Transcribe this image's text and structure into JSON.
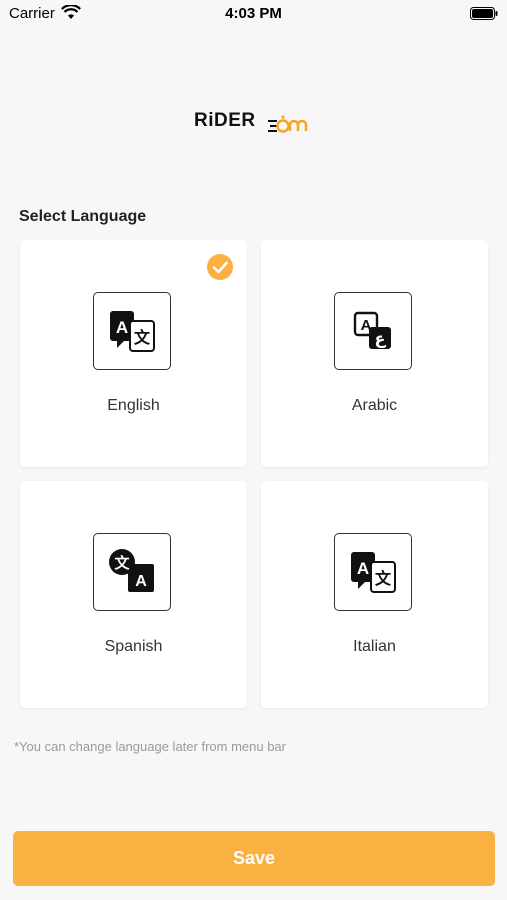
{
  "status_bar": {
    "carrier": "Carrier",
    "time": "4:03 PM",
    "icons": [
      "wifi-icon",
      "battery-icon"
    ]
  },
  "logo": {
    "text": "RiDER",
    "suffix": "oom",
    "accent_color": "#f4a623"
  },
  "section_title": "Select Language",
  "languages": [
    {
      "label": "English",
      "selected": true,
      "icon": "translate-icon"
    },
    {
      "label": "Arabic",
      "selected": false,
      "icon": "translate-icon"
    },
    {
      "label": "Spanish",
      "selected": false,
      "icon": "translate-icon"
    },
    {
      "label": "Italian",
      "selected": false,
      "icon": "translate-icon"
    }
  ],
  "note": "*You can change language later from menu bar",
  "save_button": {
    "label": "Save",
    "color": "#fbb042"
  }
}
